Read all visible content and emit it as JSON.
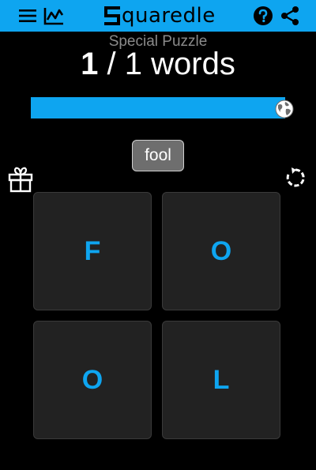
{
  "header": {
    "logo_first_letter": "S",
    "logo_rest": "quaredle",
    "icons": [
      "menu-icon",
      "stats-icon",
      "help-icon",
      "share-icon"
    ]
  },
  "puzzle": {
    "subtitle": "Special Puzzle",
    "found": "1",
    "separator": "/",
    "total": "1",
    "unit": "words",
    "progress_fraction": 1.0
  },
  "current_word": "fool",
  "board": {
    "tiles": [
      "F",
      "O",
      "O",
      "L"
    ]
  },
  "colors": {
    "accent": "#0ea5f0",
    "background": "#000000",
    "tile": "#222222",
    "chip": "#6e6e6e"
  }
}
